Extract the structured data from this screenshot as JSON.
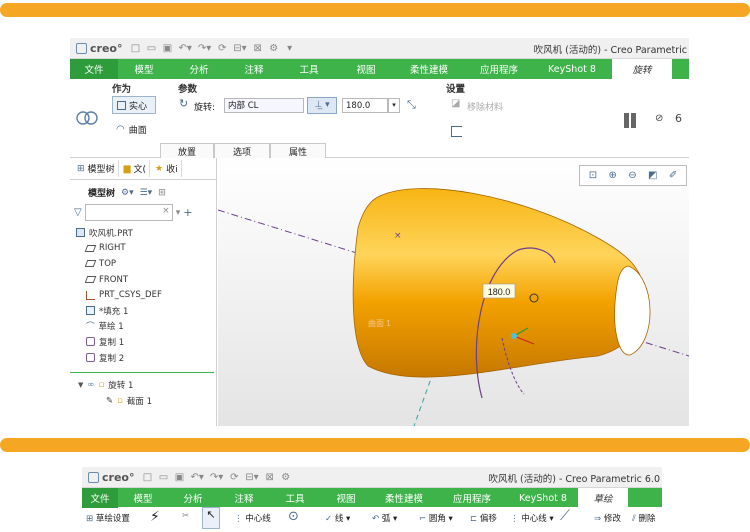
{
  "colors": {
    "accent_orange": "#f5a623",
    "menu_green": "#3db34a",
    "part_orange": "#f3a200",
    "axis_purple": "#6b3f8a",
    "axis_teal": "#3aa0a0"
  },
  "window1": {
    "logo": "creo°",
    "title": "吹风机 (活动的) - Creo Parametric",
    "menus": [
      "文件",
      "模型",
      "分析",
      "注释",
      "工具",
      "视图",
      "柔性建模",
      "应用程序",
      "KeyShot 8",
      "旋转"
    ],
    "ribbon": {
      "group_zuowei": "作为",
      "solid_btn": "实心",
      "surface_btn": "曲面",
      "group_params": "参数",
      "rotate_label": "旋转:",
      "axis_value": "内部 CL",
      "angle_value": "180.0",
      "group_settings": "设置",
      "remove_material": "移除材料",
      "subtabs": [
        "放置",
        "选项",
        "属性"
      ]
    },
    "left_tabs": {
      "model_tree": "模型树",
      "file": "文(",
      "fav": "收i"
    },
    "tree_header": "模型树",
    "tree_items": [
      {
        "label": "吹风机.PRT",
        "icon": "part-icon"
      },
      {
        "label": "RIGHT",
        "icon": "datum-plane-icon"
      },
      {
        "label": "TOP",
        "icon": "datum-plane-icon"
      },
      {
        "label": "FRONT",
        "icon": "datum-plane-icon"
      },
      {
        "label": "PRT_CSYS_DEF",
        "icon": "csys-icon"
      },
      {
        "label": "*填充 1",
        "icon": "fill-icon"
      },
      {
        "label": "草绘 1",
        "icon": "sketch-icon"
      },
      {
        "label": "复制 1",
        "icon": "copy-icon"
      },
      {
        "label": "复制 2",
        "icon": "copy-icon"
      }
    ],
    "revolve_item": "旋转 1",
    "revolve_child": "截面 1",
    "viewport": {
      "angle_tag": "180.0",
      "surface_label": "曲面 1"
    }
  },
  "window2": {
    "logo": "creo°",
    "title": "吹风机 (活动的) - Creo Parametric 6.0",
    "menus": [
      "文件",
      "模型",
      "分析",
      "注释",
      "工具",
      "视图",
      "柔性建模",
      "应用程序",
      "KeyShot 8",
      "草绘"
    ],
    "ribbon_items": [
      "草绘设置",
      "中心线",
      "线",
      "弧",
      "圆角",
      "偏移",
      "中心线",
      "修改",
      "删除"
    ]
  }
}
